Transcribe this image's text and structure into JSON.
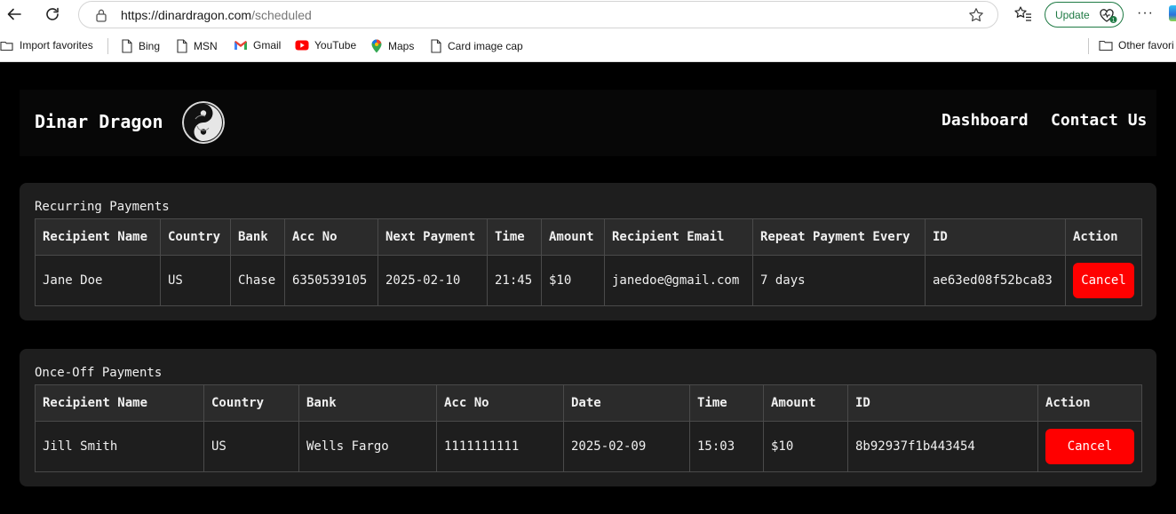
{
  "browser": {
    "url_host": "https://dinardragon.com",
    "url_path": "/scheduled",
    "update_label": "Update",
    "more_label": "···"
  },
  "bookmarks": {
    "import_favorites": "Import favorites",
    "items": [
      "Bing",
      "MSN",
      "Gmail",
      "YouTube",
      "Maps",
      "Card image cap"
    ],
    "other_favorites": "Other favori"
  },
  "site": {
    "brand": "Dinar Dragon",
    "nav": [
      "Dashboard",
      "Contact Us"
    ]
  },
  "recurring": {
    "title": "Recurring Payments",
    "columns": [
      "Recipient Name",
      "Country",
      "Bank",
      "Acc No",
      "Next Payment",
      "Time",
      "Amount",
      "Recipient Email",
      "Repeat Payment Every",
      "ID",
      "Action"
    ],
    "rows": [
      [
        "Jane Doe",
        "US",
        "Chase",
        "6350539105",
        "2025-02-10",
        "21:45",
        "$10",
        "janedoe@gmail.com",
        "7 days",
        "ae63ed08f52bca83",
        "Cancel"
      ]
    ]
  },
  "onceoff": {
    "title": "Once-Off Payments",
    "columns": [
      "Recipient Name",
      "Country",
      "Bank",
      "Acc No",
      "Date",
      "Time",
      "Amount",
      "ID",
      "Action"
    ],
    "rows": [
      [
        "Jill Smith",
        "US",
        "Wells Fargo",
        "1111111111",
        "2025-02-09",
        "15:03",
        "$10",
        "8b92937f1b443454",
        "Cancel"
      ]
    ]
  },
  "colors": {
    "cancel_button": "#ff0000",
    "card_background": "#1e1e1e",
    "page_background": "#000000"
  }
}
